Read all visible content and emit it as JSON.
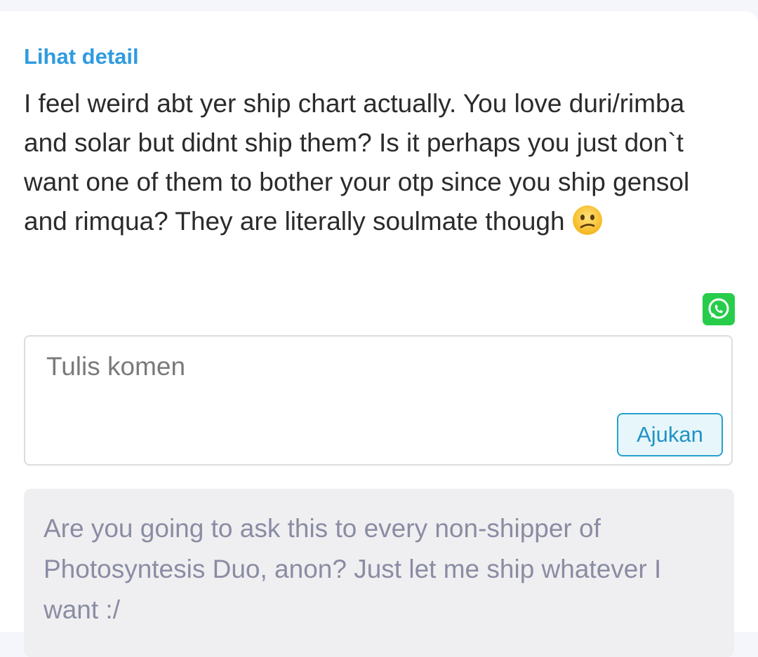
{
  "question": {
    "detail_link": "Lihat detail",
    "text": "I feel weird abt yer ship chart actually. You love duri/rimba and solar but didnt ship them? Is it perhaps you just don`t want one of them to bother your otp since you ship gensol and rimqua? They are literally soulmate though",
    "emoji": "confused-face"
  },
  "share": {
    "icon": "whatsapp-icon",
    "color": "#27cd4a"
  },
  "comment": {
    "placeholder": "Tulis komen",
    "value": "",
    "submit_label": "Ajukan"
  },
  "answer": {
    "text": "Are you going to ask this to every non-shipper of Photosyntesis Duo, anon? Just let me ship whatever I want :/"
  },
  "colors": {
    "link": "#2f9be0",
    "submit_border": "#25a0cf",
    "answer_text": "#8a8ca3",
    "answer_bg": "#efeff1"
  }
}
